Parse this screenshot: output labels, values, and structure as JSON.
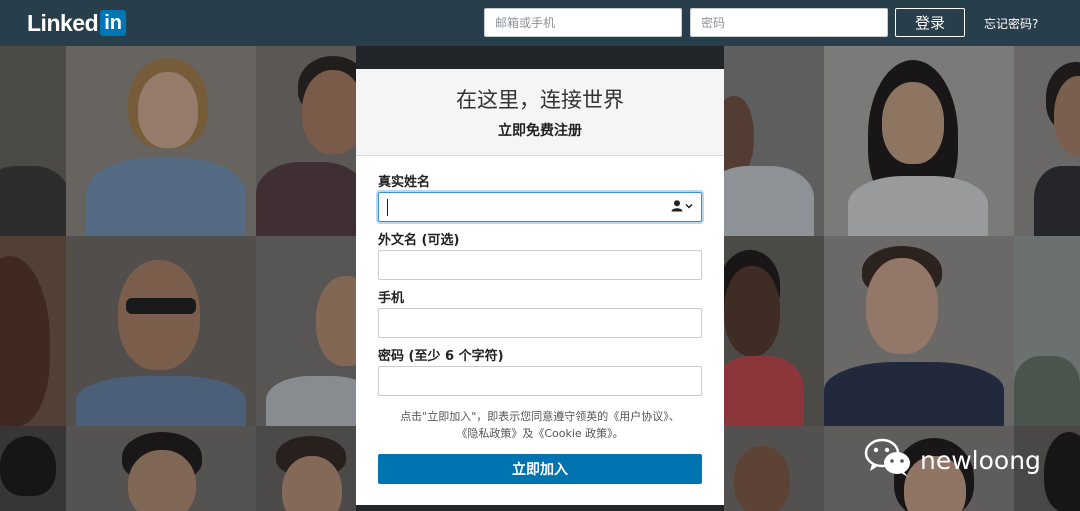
{
  "header": {
    "logo_text": "Linked",
    "logo_box_text": "in",
    "email_placeholder": "邮箱或手机",
    "password_placeholder": "密码",
    "login_label": "登录",
    "forgot_label": "忘记密码?"
  },
  "signup": {
    "title": "在这里，连接世界",
    "subtitle": "立即免费注册",
    "fields": [
      {
        "label": "真实姓名",
        "value": ""
      },
      {
        "label": "外文名 (可选)",
        "value": ""
      },
      {
        "label": "手机",
        "value": ""
      },
      {
        "label": "密码 (至少 6 个字符)",
        "value": ""
      }
    ],
    "terms_line1": "点击\"立即加入\"，即表示您同意遵守领英的《用户协议》、",
    "terms_line2": "《隐私政策》及《Cookie 政策》。",
    "join_label": "立即加入"
  },
  "watermark": {
    "text": "newloong",
    "icon": "wechat-icon"
  },
  "colors": {
    "topbar": "#283e4a",
    "brand": "#0077b5",
    "join_button": "#0073b1"
  }
}
